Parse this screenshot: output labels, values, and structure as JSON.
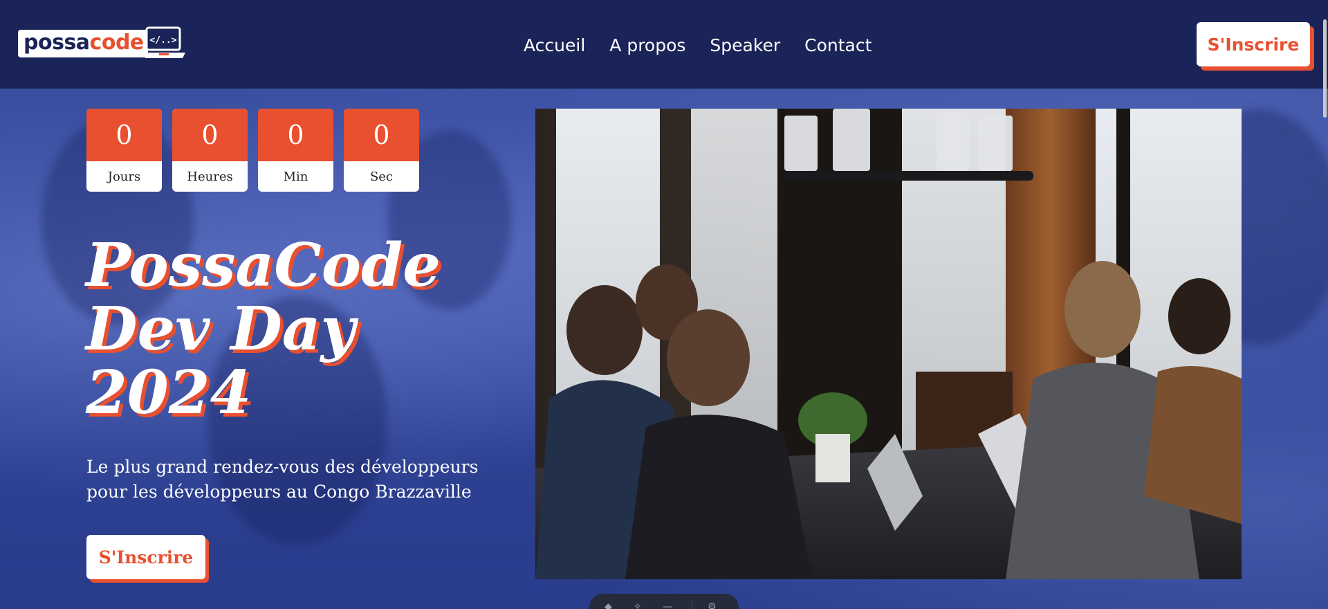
{
  "header": {
    "logo": {
      "part1": "possa",
      "part2": "code",
      "badge": "</..>"
    },
    "nav": [
      {
        "label": "Accueil"
      },
      {
        "label": "A propos"
      },
      {
        "label": "Speaker"
      },
      {
        "label": "Contact"
      }
    ],
    "cta_label": "S'Inscrire"
  },
  "countdown": [
    {
      "value": "0",
      "label": "Jours"
    },
    {
      "value": "0",
      "label": "Heures"
    },
    {
      "value": "0",
      "label": "Min"
    },
    {
      "value": "0",
      "label": "Sec"
    }
  ],
  "hero": {
    "title_lines": [
      "PossaCode",
      "Dev Day",
      "2024"
    ],
    "subtitle": "Le plus grand rendez-vous des développeurs pour les développeurs au Congo Brazzaville",
    "cta_label": "S'Inscrire"
  },
  "colors": {
    "accent": "#e8502f",
    "navy": "#1b2458",
    "hero_blue": "#2f4395"
  }
}
